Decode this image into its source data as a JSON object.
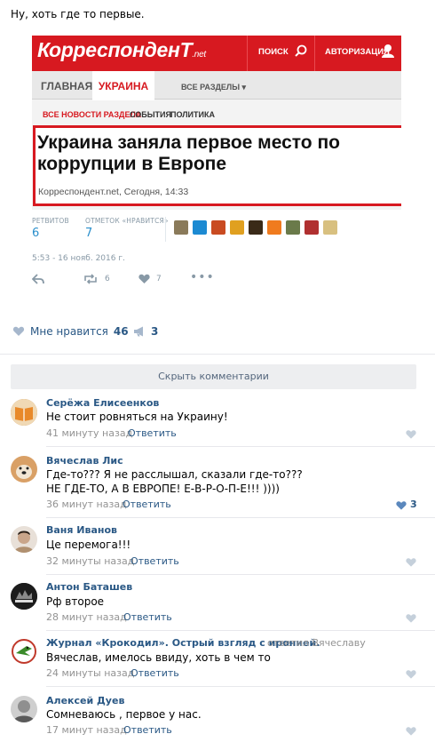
{
  "post": {
    "text": "Ну, хоть где то первые."
  },
  "embed": {
    "brand": "КорреспонденТ",
    "brand_suffix": ".net",
    "search_label": "ПОИСК",
    "auth_label": "АВТОРИЗАЦИЯ",
    "nav": {
      "home": "ГЛАВНАЯ",
      "ukraine": "УКРАИНА",
      "all_sections": "ВСЕ РАЗДЕЛЫ ▾"
    },
    "subnav": {
      "all_news": "ВСЕ НОВОСТИ РАЗДЕЛА",
      "events": "СОБЫТИЯ",
      "politics": "ПОЛИТИКА"
    },
    "headline": "Украина заняла первое место по коррупции в Европе",
    "source": "Корреспондент.net, Сегодня, 14:33"
  },
  "tweet": {
    "retweets_label": "РЕТВИТОВ",
    "retweets": "6",
    "likes_label": "ОТМЕТОК «НРАВИТСЯ»",
    "likes": "7",
    "date": "5:53 - 16 нояб. 2016 г.",
    "retweet_count": "6",
    "like_count": "7",
    "avatar_colors": [
      "#8a7a5a",
      "#1c8ad2",
      "#c94b21",
      "#e0a020",
      "#3a2a18",
      "#f07b1e",
      "#6a7a4a",
      "#b03030",
      "#d8c080"
    ]
  },
  "reactions": {
    "like_label": "Мне нравится",
    "like_count": "46",
    "share_count": "3"
  },
  "hide_comments": "Скрыть комментарии",
  "comments": [
    {
      "author": "Серёжа Елисеенков",
      "text": "Не стоит ровняться на Украину!",
      "time": "41 минуту назад",
      "reply": "Ответить",
      "likes": ""
    },
    {
      "author": "Вячеслав Лис",
      "text1": "Где-то??? Я не расслышал, сказали где-то???",
      "text2": "НЕ ГДЕ-ТО, А В ЕВРОПЕ! Е-В-Р-О-П-Е!!! ))))",
      "time": "36 минут назад",
      "reply": "Ответить",
      "likes": "3"
    },
    {
      "author": "Ваня Иванов",
      "text": "Це перемога!!!",
      "time": "32 минуты назад",
      "reply": "Ответить",
      "likes": ""
    },
    {
      "author": "Антон Баташев",
      "text": "Рф второе",
      "time": "28 минут назад",
      "reply": "Ответить",
      "likes": ""
    },
    {
      "author": "Журнал «Крокодил». Острый взгляд с иронией.",
      "reply_to": "ответил Вячеславу",
      "text": "Вячеслав, имелось ввиду, хоть в чем то",
      "time": "24 минуты назад",
      "reply": "Ответить",
      "likes": ""
    },
    {
      "author": "Алексей Дуев",
      "text": "Сомневаюсь , первое у нас.",
      "time": "17 минут назад",
      "reply": "Ответить",
      "likes": ""
    }
  ],
  "colors": {
    "brand_red": "#d71920",
    "link_blue": "#2a5885",
    "twitter_blue": "#2a8fcc",
    "muted": "#939393"
  }
}
